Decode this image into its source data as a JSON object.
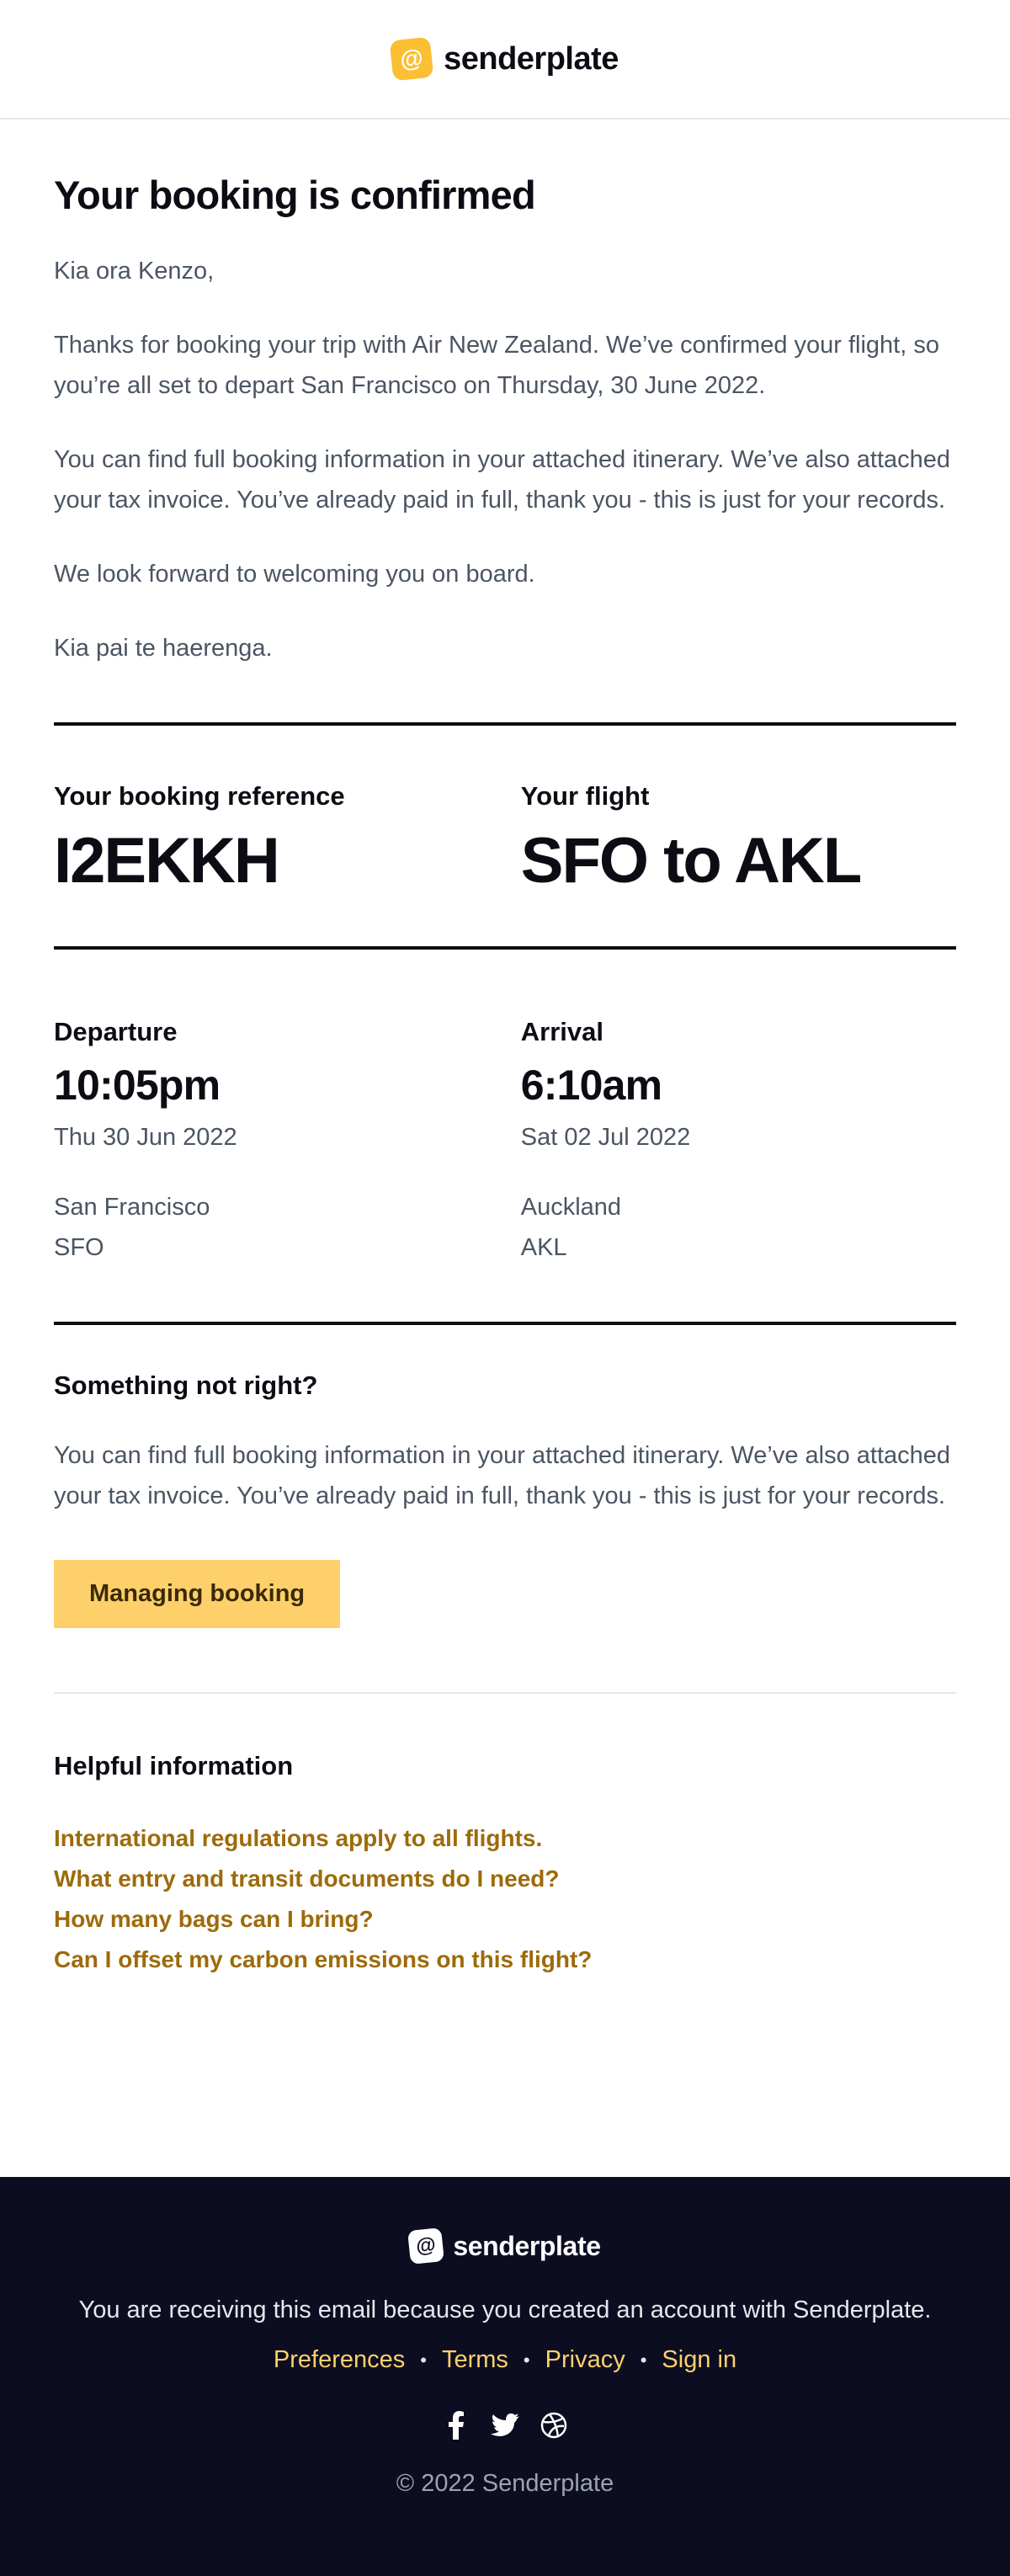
{
  "brand": {
    "name": "senderplate",
    "logo_icon": "at-sign-icon",
    "accent_color": "#fbbf33"
  },
  "email": {
    "title": "Your booking is confirmed",
    "greeting": "Kia ora Kenzo,",
    "paragraphs": [
      "Thanks for booking your trip with Air New Zealand. We’ve confirmed your flight, so you’re all set to depart San Francisco on Thursday, 30 June 2022.",
      "You can find full booking information in your attached itinerary. We’ve also attached your tax invoice. You’ve already paid in full, thank you - this is just for your records.",
      "We look forward to welcoming you on board.",
      "Kia pai te haerenga."
    ]
  },
  "booking": {
    "reference_label": "Your booking reference",
    "reference": "I2EKKH",
    "flight_label": "Your flight",
    "flight": "SFO to AKL"
  },
  "departure": {
    "label": "Departure",
    "time": "10:05pm",
    "date": "Thu 30 Jun 2022",
    "city": "San Francisco",
    "code": "SFO"
  },
  "arrival": {
    "label": "Arrival",
    "time": "6:10am",
    "date": "Sat 02 Jul 2022",
    "city": "Auckland",
    "code": "AKL"
  },
  "issue": {
    "heading": "Something not right?",
    "text": "You can find full booking information in your attached itinerary. We’ve also attached your tax invoice. You’ve already paid in full, thank you - this is just for your records.",
    "button_label": "Managing booking"
  },
  "helpful": {
    "heading": "Helpful information",
    "links": [
      "International regulations apply to all flights.",
      "What entry and transit documents do I need?",
      "How many bags can I bring?",
      "Can I offset my carbon emissions on this flight?"
    ]
  },
  "footer": {
    "brand": "senderplate",
    "notice": "You are receiving this email because you created an account with Senderplate.",
    "links": [
      "Preferences",
      "Terms",
      "Privacy",
      "Sign in"
    ],
    "social_icons": [
      "facebook-icon",
      "twitter-icon",
      "dribbble-icon"
    ],
    "copyright": "© 2022 Senderplate",
    "background_color": "#0c0d20"
  }
}
